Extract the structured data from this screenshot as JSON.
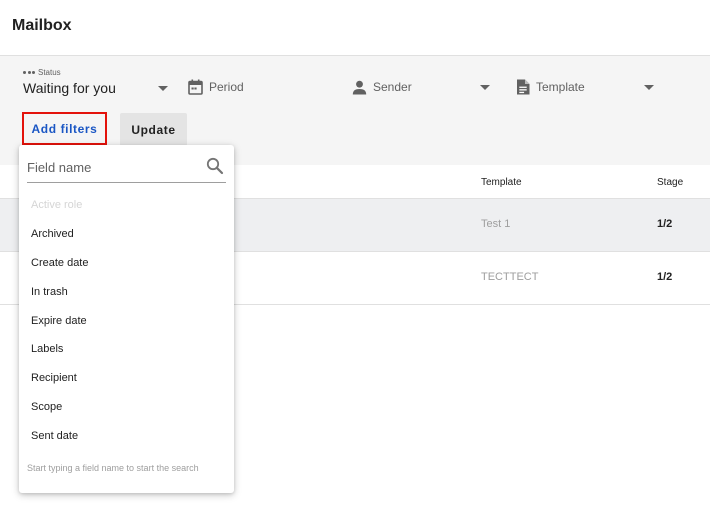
{
  "header": {
    "title": "Mailbox"
  },
  "filters": {
    "status": {
      "caption": "Status",
      "value": "Waiting for you"
    },
    "period": {
      "label": "Period"
    },
    "sender": {
      "label": "Sender"
    },
    "template": {
      "label": "Template"
    },
    "add_filters_label": "Add filters",
    "update_label": "Update"
  },
  "table": {
    "columns": {
      "template": "Template",
      "stage": "Stage"
    },
    "rows": [
      {
        "template": "Test 1",
        "stage": "1/2"
      },
      {
        "template": "TECTTECT",
        "stage": "1/2"
      }
    ]
  },
  "dropdown": {
    "placeholder": "Field name",
    "items": [
      {
        "label": "Active role",
        "disabled": true
      },
      {
        "label": "Archived"
      },
      {
        "label": "Create date"
      },
      {
        "label": "In trash"
      },
      {
        "label": "Expire date"
      },
      {
        "label": "Labels"
      },
      {
        "label": "Recipient"
      },
      {
        "label": "Scope"
      },
      {
        "label": "Sent date"
      }
    ],
    "hint": "Start typing a field name to start the search"
  },
  "colors": {
    "accent": "#1a56c4",
    "highlight_border": "#e3120b",
    "filter_bar_bg": "#f5f5f5",
    "selected_row_bg": "#eeeff1"
  }
}
